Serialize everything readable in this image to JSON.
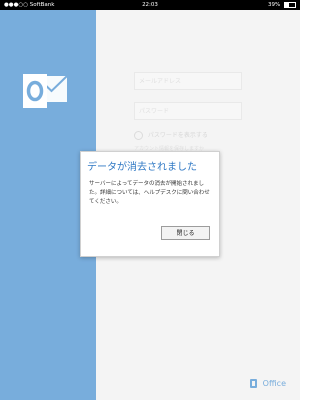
{
  "statusbar": {
    "carrier": "●●●○○ SoftBank",
    "time": "22:03",
    "battery": "39%"
  },
  "login": {
    "email_placeholder": "メールアドレス",
    "password_placeholder": "パスワード",
    "show_password_label": "パスワードを表示する",
    "hint_text": "アカウント情報を保存しますか"
  },
  "brand": {
    "office_label": "Office",
    "accent_color": "#5b9bd5"
  },
  "dialog": {
    "title": "データが消去されました",
    "message": "サーバーによってデータの消去が開始されました。詳細については、ヘルプデスクに問い合わせてください。",
    "button_label": "閉じる"
  }
}
